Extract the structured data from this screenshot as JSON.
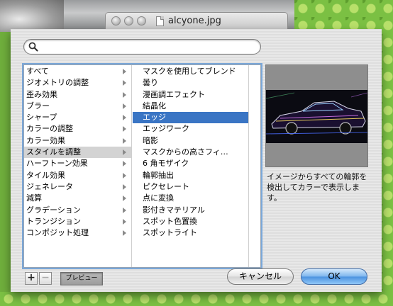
{
  "window": {
    "title": "alcyone.jpg"
  },
  "search": {
    "placeholder": "",
    "value": ""
  },
  "categories": [
    {
      "label": "すべて",
      "state": "normal"
    },
    {
      "label": "ジオメトリの調整",
      "state": "normal"
    },
    {
      "label": "歪み効果",
      "state": "normal"
    },
    {
      "label": "ブラー",
      "state": "normal"
    },
    {
      "label": "シャープ",
      "state": "normal"
    },
    {
      "label": "カラーの調整",
      "state": "normal"
    },
    {
      "label": "カラー効果",
      "state": "normal"
    },
    {
      "label": "スタイルを調整",
      "state": "selected-inactive"
    },
    {
      "label": "ハーフトーン効果",
      "state": "normal"
    },
    {
      "label": "タイル効果",
      "state": "normal"
    },
    {
      "label": "ジェネレータ",
      "state": "normal"
    },
    {
      "label": "減算",
      "state": "normal"
    },
    {
      "label": "グラデーション",
      "state": "normal"
    },
    {
      "label": "トランジション",
      "state": "normal"
    },
    {
      "label": "コンポジット処理",
      "state": "normal"
    }
  ],
  "filters": [
    {
      "label": "マスクを使用してブレンド",
      "state": "normal"
    },
    {
      "label": "曇り",
      "state": "normal"
    },
    {
      "label": "漫画調エフェクト",
      "state": "normal"
    },
    {
      "label": "結晶化",
      "state": "normal"
    },
    {
      "label": "エッジ",
      "state": "selected"
    },
    {
      "label": "エッジワーク",
      "state": "normal"
    },
    {
      "label": "暗影",
      "state": "normal"
    },
    {
      "label": "マスクからの高さフィ…",
      "state": "normal"
    },
    {
      "label": "6 角モザイク",
      "state": "normal"
    },
    {
      "label": "輪郭抽出",
      "state": "normal"
    },
    {
      "label": "ピクセレート",
      "state": "normal"
    },
    {
      "label": "点に変換",
      "state": "normal"
    },
    {
      "label": "影付きマテリアル",
      "state": "normal"
    },
    {
      "label": "スポット色置換",
      "state": "normal"
    },
    {
      "label": "スポットライト",
      "state": "normal"
    }
  ],
  "description": {
    "line1": "イメージからすべての輪郭を",
    "line2": "検出してカラーで表示しま",
    "line3": "す。"
  },
  "buttons": {
    "add": "+",
    "remove": "−",
    "preview": "プレビュー",
    "cancel": "キャンセル",
    "ok": "OK"
  },
  "colors": {
    "selection": "#3a75c4",
    "inactive_selection": "#d3d3d3",
    "default_button": "#4c93e0"
  }
}
